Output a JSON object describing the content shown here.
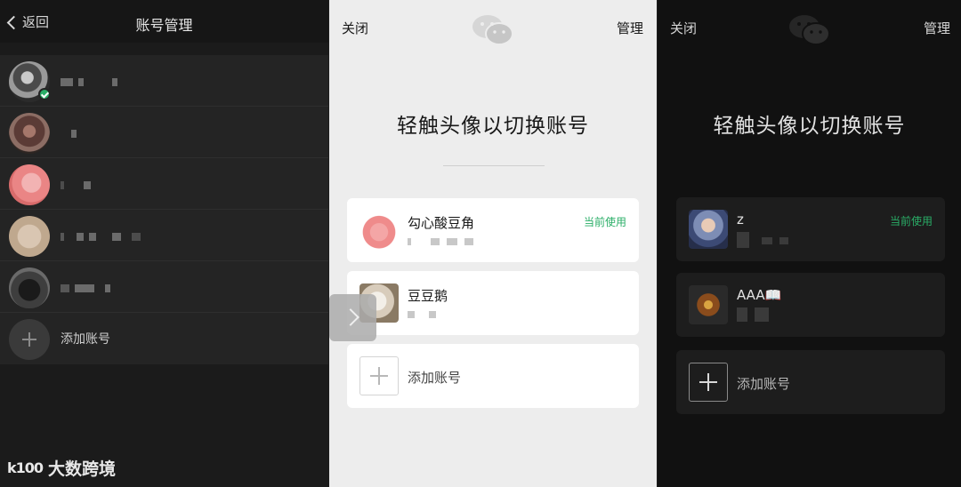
{
  "left": {
    "back_label": "返回",
    "title": "账号管理",
    "accounts": [
      {
        "avatar": "account-avatar-1",
        "masked": true,
        "current": true
      },
      {
        "avatar": "account-avatar-2",
        "masked": true
      },
      {
        "avatar": "account-avatar-3",
        "masked": true
      },
      {
        "avatar": "account-avatar-4",
        "masked": true
      },
      {
        "avatar": "account-avatar-5",
        "masked": true
      }
    ],
    "add_label": "添加账号"
  },
  "watermark": {
    "logo": "k100",
    "text": "大数跨境"
  },
  "middle": {
    "close_label": "关闭",
    "manage_label": "管理",
    "logo_icon": "wechat-logo-icon",
    "heading": "轻触头像以切换账号",
    "accounts": [
      {
        "name": "勾心酸豆角",
        "status": "当前使用"
      },
      {
        "name": "豆豆鹅",
        "status": ""
      }
    ],
    "add_label": "添加账号"
  },
  "swipe_icon": "chevron-right-icon",
  "right": {
    "close_label": "关闭",
    "manage_label": "管理",
    "logo_icon": "wechat-logo-icon",
    "heading": "轻触头像以切换账号",
    "accounts": [
      {
        "name": "z",
        "status": "当前使用"
      },
      {
        "name": "AAA📖",
        "status": ""
      }
    ],
    "add_label": "添加账号"
  },
  "colors": {
    "accent_green": "#2aae67",
    "light_bg": "#ededed",
    "dark_bg": "#111111"
  }
}
